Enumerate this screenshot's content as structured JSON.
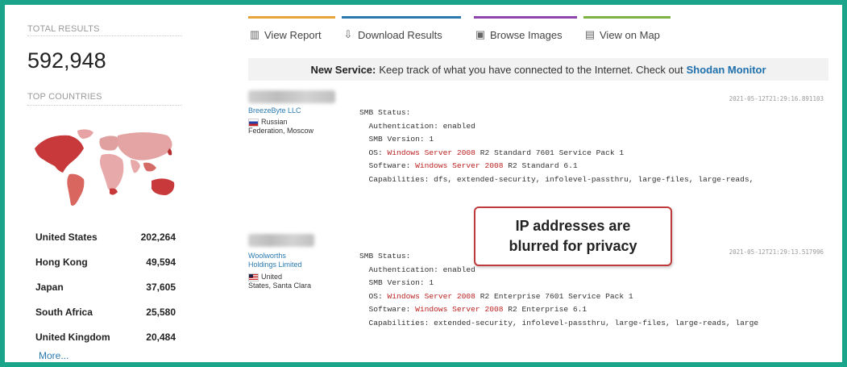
{
  "sidebar": {
    "total_results_label": "TOTAL RESULTS",
    "total_results_value": "592,948",
    "top_countries_label": "TOP COUNTRIES",
    "countries": [
      {
        "name": "United States",
        "count": "202,264"
      },
      {
        "name": "Hong Kong",
        "count": "49,594"
      },
      {
        "name": "Japan",
        "count": "37,605"
      },
      {
        "name": "South Africa",
        "count": "25,580"
      },
      {
        "name": "United Kingdom",
        "count": "20,484"
      }
    ],
    "more_label": "More..."
  },
  "toolbar": {
    "items": [
      {
        "label": "View Report",
        "icon": "chart-icon",
        "accent": "#e8a33c"
      },
      {
        "label": "Download Results",
        "icon": "download-icon",
        "accent": "#2a7ab0"
      },
      {
        "label": "Browse Images",
        "icon": "image-icon",
        "accent": "#8e44ad"
      },
      {
        "label": "View on Map",
        "icon": "map-icon",
        "accent": "#7cb342"
      }
    ]
  },
  "banner": {
    "bold": "New Service:",
    "text": "Keep track of what you have connected to the Internet. Check out",
    "link": "Shodan Monitor"
  },
  "results": [
    {
      "org": "BreezeByte LLC",
      "location_line1": "Russian",
      "location_line2": "Federation, Moscow",
      "timestamp": "2021-05-12T21:29:16.891103",
      "lines": {
        "status": "SMB Status:",
        "auth": "  Authentication: enabled",
        "version": "  SMB Version: 1",
        "os_prefix": "  OS: ",
        "os_red": "Windows Server 2008",
        "os_rest": " R2 Standard 7601 Service Pack 1",
        "sw_prefix": "  Software: ",
        "sw_red": "Windows Server 2008",
        "sw_rest": " R2 Standard 6.1",
        "caps": "  Capabilities: dfs, extended-security, infolevel-passthru, large-files, large-reads,"
      }
    },
    {
      "org": "Woolworths Holdings Limited",
      "location_line1": "United",
      "location_line2": "States, Santa Clara",
      "timestamp": "2021-05-12T21:29:13.517996",
      "lines": {
        "status": "SMB Status:",
        "auth": "  Authentication: enabled",
        "version": "  SMB Version: 1",
        "os_prefix": "  OS: ",
        "os_red": "Windows Server 2008",
        "os_rest": " R2 Enterprise 7601 Service Pack 1",
        "sw_prefix": "  Software: ",
        "sw_red": "Windows Server 2008",
        "sw_rest": " R2 Enterprise 6.1",
        "caps": "  Capabilities: extended-security, infolevel-passthru, large-files, large-reads, large"
      }
    }
  ],
  "callout": {
    "line1": "IP addresses are",
    "line2": "blurred for privacy"
  }
}
